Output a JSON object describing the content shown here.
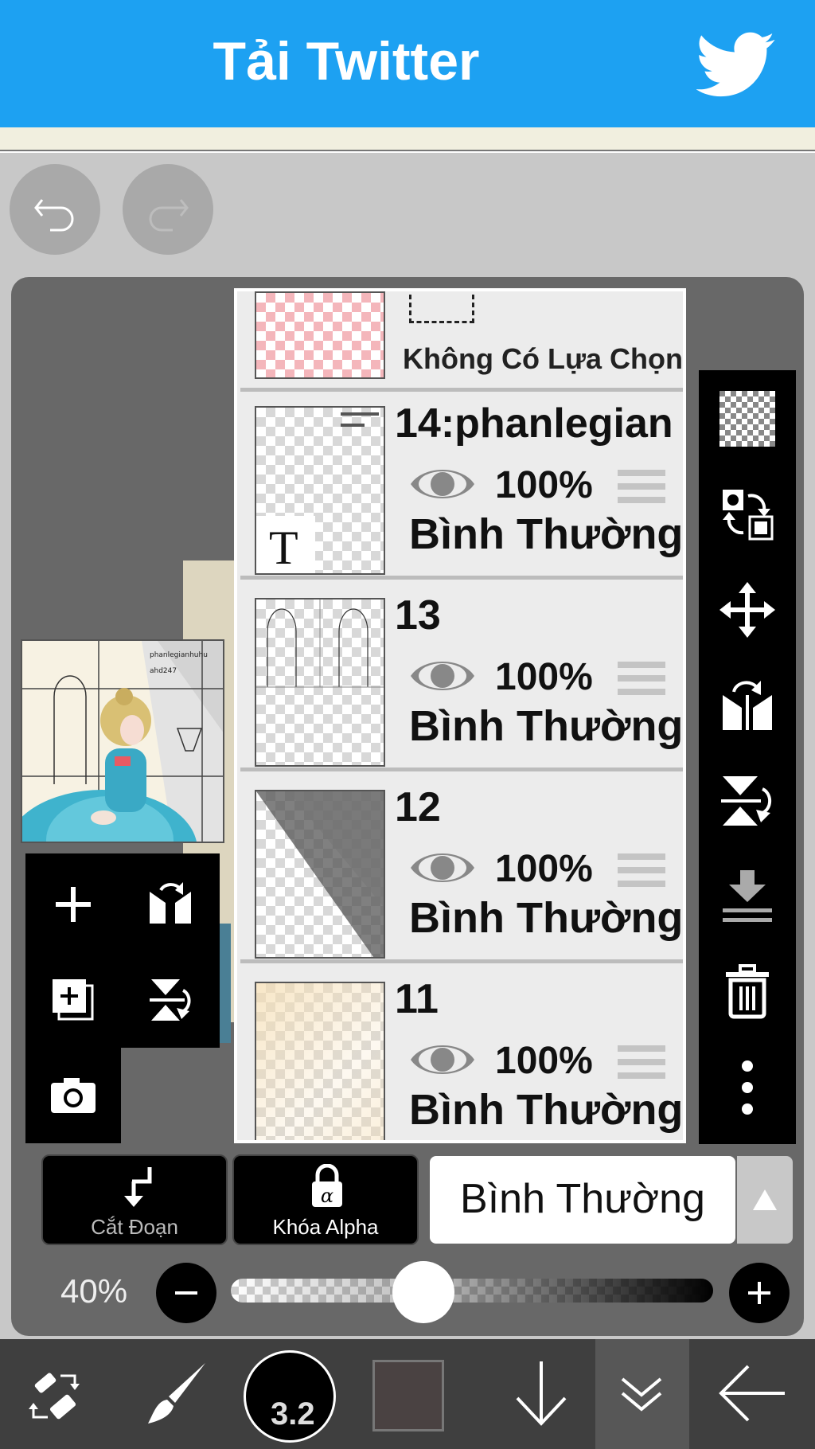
{
  "banner": {
    "title": "Tải Twitter"
  },
  "layers": {
    "selection": {
      "label": "Không Có Lựa Chọn"
    },
    "items": [
      {
        "name": "14:phanlegian",
        "opacity": "100%",
        "blend": "Bình Thường"
      },
      {
        "name": "13",
        "opacity": "100%",
        "blend": "Bình Thường"
      },
      {
        "name": "12",
        "opacity": "100%",
        "blend": "Bình Thường"
      },
      {
        "name": "11",
        "opacity": "100%",
        "blend": "Bình Thường"
      }
    ],
    "text_layer_glyph": "T"
  },
  "controls": {
    "clipping_label": "Cắt Đoạn",
    "alpha_lock_label": "Khóa Alpha",
    "blend_mode_value": "Bình Thường",
    "opacity_label": "40%",
    "opacity_value": 0.4
  },
  "toolbar": {
    "brush_size": "3.2",
    "current_color": "#4a4242"
  },
  "icons": [
    "twitter-bird-icon",
    "undo-icon",
    "redo-icon",
    "add-layer-icon",
    "flip-horizontal-icon",
    "duplicate-layer-icon",
    "flip-vertical-icon",
    "camera-icon",
    "transparent-checker-icon",
    "swap-icon",
    "move-icon",
    "flip-layer-horizontal-icon",
    "flip-layer-vertical-icon",
    "merge-down-icon",
    "trash-icon",
    "more-vertical-icon",
    "clipping-arrow-icon",
    "alpha-lock-icon",
    "triangle-up-icon",
    "minus-icon",
    "plus-icon",
    "eye-icon",
    "transform-icon",
    "brush-icon",
    "arrow-down-icon",
    "double-chevron-down-icon",
    "back-arrow-icon"
  ]
}
